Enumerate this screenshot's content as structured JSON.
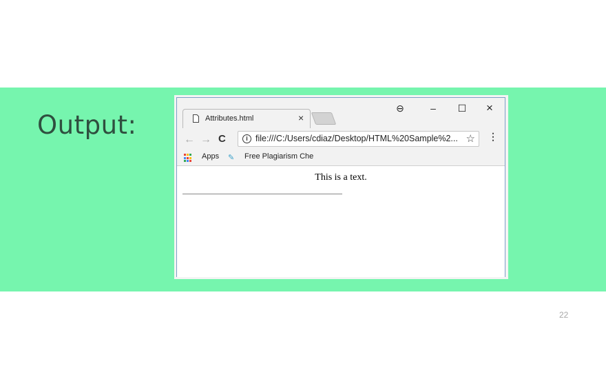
{
  "slide": {
    "output_label": "Output:",
    "page_number": "22",
    "band_color": "#76f5ae"
  },
  "browser": {
    "tab_title": "Attributes.html",
    "tab_close": "×",
    "window_controls": {
      "account": "⊖",
      "minimize": "–",
      "maximize": "☐",
      "close": "×"
    },
    "nav": {
      "back": "←",
      "forward": "→",
      "reload": "C"
    },
    "url": "file:///C:/Users/cdiaz/Desktop/HTML%20Sample%2...",
    "star": "☆",
    "menu": "⋮",
    "bookmarks": [
      {
        "label": "Apps",
        "icon": "apps-grid-icon"
      },
      {
        "label": "Free Plagiarism Chec",
        "icon": "bookmark-site-icon"
      }
    ]
  },
  "page": {
    "text": "This is a text."
  }
}
